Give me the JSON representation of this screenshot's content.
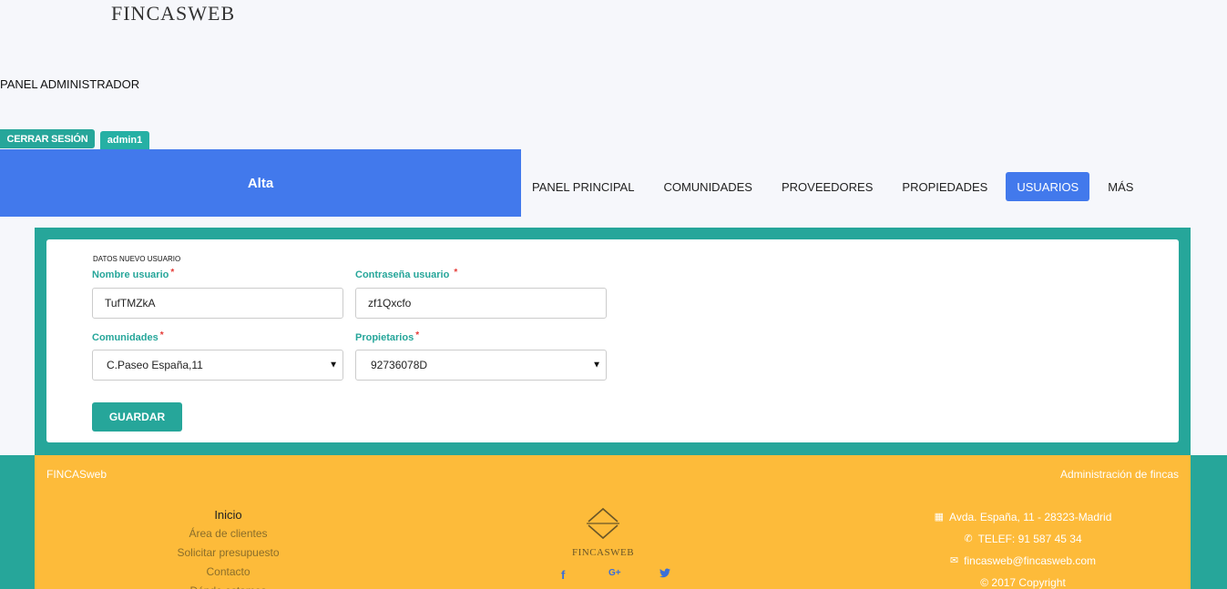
{
  "header": {
    "brand": "FINCASWEB",
    "panel_title": "PANEL ADMINISTRADOR",
    "logout_label": "CERRAR SESIÓN",
    "user_label": "admin1"
  },
  "section_title": "Alta",
  "nav": {
    "items": [
      {
        "label": "PANEL PRINCIPAL"
      },
      {
        "label": "COMUNIDADES"
      },
      {
        "label": "PROVEEDORES"
      },
      {
        "label": "PROPIEDADES"
      },
      {
        "label": "USUARIOS"
      },
      {
        "label": "MÁS"
      }
    ],
    "active": "USUARIOS"
  },
  "form": {
    "heading": "DATOS NUEVO USUARIO",
    "username_label": "Nombre usuario",
    "username_value": "TufTMZkA",
    "password_label": "Contraseña usuario",
    "password_value": "zf1Qxcfo",
    "communities_label": "Comunidades",
    "communities_value": "C.Paseo España,11",
    "owners_label": "Propietarios",
    "owners_value": "92736078D",
    "required_mark": "*",
    "save_label": "GUARDAR"
  },
  "footer": {
    "brand": "FINCASweb",
    "tagline": "Administración de fincas",
    "links": [
      {
        "label": "Inicio"
      },
      {
        "label": "Área de clientes"
      },
      {
        "label": "Solicitar presupuesto"
      },
      {
        "label": "Contacto"
      },
      {
        "label": "Dónde estamos"
      }
    ],
    "logo_text": "FINCASWEB",
    "social": {
      "facebook": "f",
      "google": "G+",
      "twitter": "🐦"
    },
    "address": "Avda. España, 11 - 28323-Madrid",
    "phone": "TELEF: 91 587 45 34",
    "email": "fincasweb@fincasweb.com",
    "copyright": "© 2017 Copyright"
  },
  "colors": {
    "teal": "#26a69a",
    "blue": "#4279ec",
    "footer_yellow": "#fdbb3a"
  }
}
